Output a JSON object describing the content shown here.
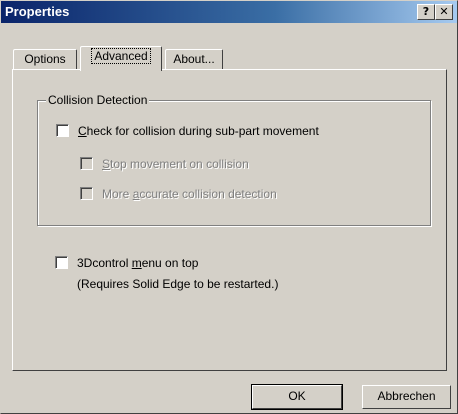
{
  "window": {
    "title": "Properties",
    "help_label": "?",
    "close_label": "✕"
  },
  "tabs": [
    {
      "label": "Options",
      "active": false
    },
    {
      "label": "Advanced",
      "active": true
    },
    {
      "label": "About...",
      "active": false
    }
  ],
  "collision_group": {
    "title": "Collision Detection",
    "check_collision": {
      "label_pre": "",
      "mnemonic": "C",
      "label_post": "heck for collision during sub-part movement",
      "checked": false,
      "enabled": true
    },
    "stop_movement": {
      "label_pre": "",
      "mnemonic": "S",
      "label_post": "top movement on collision",
      "checked": false,
      "enabled": false
    },
    "more_accurate": {
      "label_pre": "More ",
      "mnemonic": "a",
      "label_post": "ccurate collision detection",
      "checked": false,
      "enabled": false
    }
  },
  "menu_on_top": {
    "label_pre": "3Dcontrol ",
    "mnemonic": "m",
    "label_post": "enu on top",
    "note": "(Requires Solid Edge to be restarted.)",
    "checked": false
  },
  "buttons": {
    "ok": "OK",
    "cancel": "Abbrechen"
  }
}
